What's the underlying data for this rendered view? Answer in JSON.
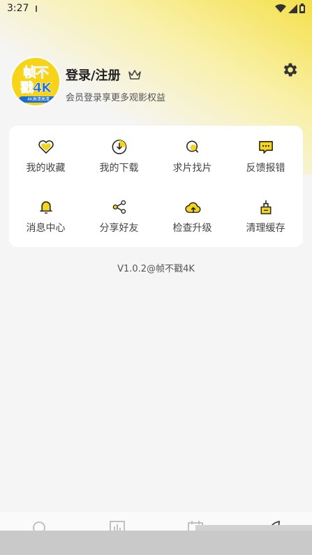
{
  "status_bar": {
    "time": "3:27"
  },
  "profile": {
    "avatar": {
      "line1": "帧不",
      "line2": "戳4K",
      "tag": "4K高清高清"
    },
    "title": "登录/注册",
    "subtitle": "会员登录享更多观影权益"
  },
  "colors": {
    "accent": "#f4d51c",
    "text": "#222222",
    "secondary": "#555555",
    "card": "#ffffff"
  },
  "menu": {
    "items": [
      {
        "label": "我的收藏",
        "icon": "heart-icon"
      },
      {
        "label": "我的下载",
        "icon": "download-icon"
      },
      {
        "label": "求片找片",
        "icon": "search-icon"
      },
      {
        "label": "反馈报错",
        "icon": "feedback-icon"
      },
      {
        "label": "消息中心",
        "icon": "bell-icon"
      },
      {
        "label": "分享好友",
        "icon": "share-icon"
      },
      {
        "label": "检查升级",
        "icon": "cloud-upload-icon"
      },
      {
        "label": "清理缓存",
        "icon": "broom-icon"
      }
    ]
  },
  "version": "V1.0.2@帧不戳4K",
  "tabbar": {
    "tabs": [
      "home-icon",
      "chart-icon",
      "calendar-icon",
      "leaf-icon"
    ]
  }
}
